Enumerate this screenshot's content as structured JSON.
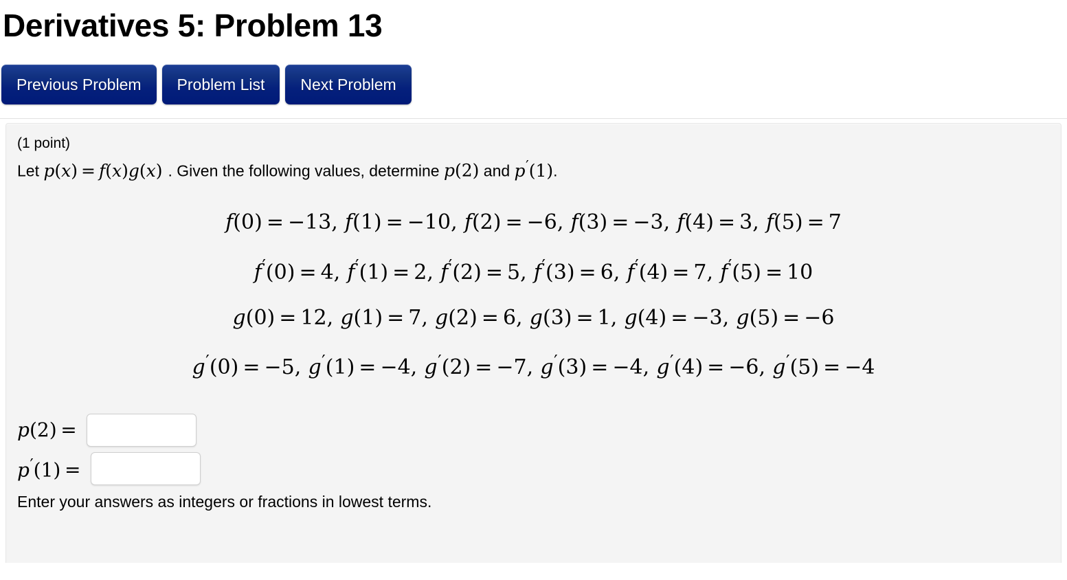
{
  "page": {
    "title": "Derivatives 5: Problem 13"
  },
  "nav": {
    "buttons": [
      {
        "label": "Previous Problem",
        "name": "previous-problem-button"
      },
      {
        "label": "Problem List",
        "name": "problem-list-button"
      },
      {
        "label": "Next Problem",
        "name": "next-problem-button"
      }
    ]
  },
  "problem": {
    "points": "(1 point)",
    "prompt": {
      "lead": "Let",
      "definition": "p(x) = f(x)g(x)",
      "middle": ". Given the following values, determine",
      "target_a": "p(2)",
      "conjunction": "and",
      "target_b": "p′(1)",
      "end": "."
    },
    "equations": [
      {
        "function": "f",
        "prime": false,
        "values": [
          {
            "x": "0",
            "y": "−13"
          },
          {
            "x": "1",
            "y": "−10"
          },
          {
            "x": "2",
            "y": "−6"
          },
          {
            "x": "3",
            "y": "−3"
          },
          {
            "x": "4",
            "y": "3"
          },
          {
            "x": "5",
            "y": "7"
          }
        ]
      },
      {
        "function": "f",
        "prime": true,
        "values": [
          {
            "x": "0",
            "y": "4"
          },
          {
            "x": "1",
            "y": "2"
          },
          {
            "x": "2",
            "y": "5"
          },
          {
            "x": "3",
            "y": "6"
          },
          {
            "x": "4",
            "y": "7"
          },
          {
            "x": "5",
            "y": "10"
          }
        ]
      },
      {
        "function": "g",
        "prime": false,
        "values": [
          {
            "x": "0",
            "y": "12"
          },
          {
            "x": "1",
            "y": "7"
          },
          {
            "x": "2",
            "y": "6"
          },
          {
            "x": "3",
            "y": "1"
          },
          {
            "x": "4",
            "y": "−3"
          },
          {
            "x": "5",
            "y": "−6"
          }
        ]
      },
      {
        "function": "g",
        "prime": true,
        "values": [
          {
            "x": "0",
            "y": "−5"
          },
          {
            "x": "1",
            "y": "−4"
          },
          {
            "x": "2",
            "y": "−7"
          },
          {
            "x": "3",
            "y": "−4"
          },
          {
            "x": "4",
            "y": "−6"
          },
          {
            "x": "5",
            "y": "−4"
          }
        ]
      }
    ],
    "answers": [
      {
        "label_fn": "p",
        "label_prime": false,
        "label_arg": "2",
        "value": "",
        "placeholder": ""
      },
      {
        "label_fn": "p",
        "label_prime": true,
        "label_arg": "1",
        "value": "",
        "placeholder": ""
      }
    ],
    "note": "Enter your answers as integers or fractions in lowest terms."
  },
  "colors": {
    "button_top": "#1d3f96",
    "button_bottom": "#001a78",
    "panel_bg": "#f4f4f4",
    "panel_border": "#e6e6e6",
    "input_border": "#cfcfcf",
    "page_bg": "#ffffff",
    "text": "#000000"
  }
}
